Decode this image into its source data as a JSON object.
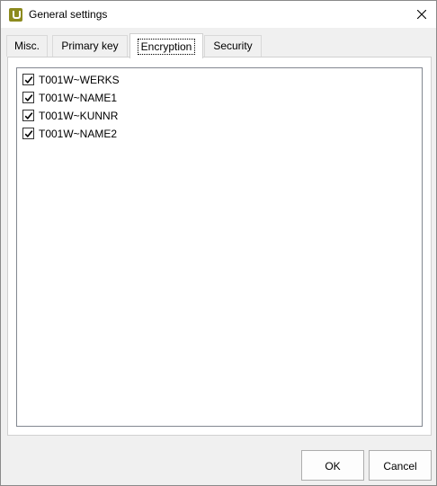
{
  "window": {
    "title": "General settings"
  },
  "icons": {
    "app": "app-logo-icon",
    "close": "close-icon",
    "check": "checkmark-icon"
  },
  "tabs": [
    {
      "label": "Misc.",
      "selected": false
    },
    {
      "label": "Primary key",
      "selected": false
    },
    {
      "label": "Encryption",
      "selected": true
    },
    {
      "label": "Security",
      "selected": false
    }
  ],
  "encryption": {
    "fields": [
      {
        "label": "T001W~WERKS",
        "checked": true
      },
      {
        "label": "T001W~NAME1",
        "checked": true
      },
      {
        "label": "T001W~KUNNR",
        "checked": true
      },
      {
        "label": "T001W~NAME2",
        "checked": true
      }
    ]
  },
  "buttons": {
    "ok": "OK",
    "cancel": "Cancel"
  },
  "colors": {
    "app_icon": "#8c8a1e",
    "window_bg": "#f0f0f0",
    "panel_bg": "#ffffff"
  }
}
